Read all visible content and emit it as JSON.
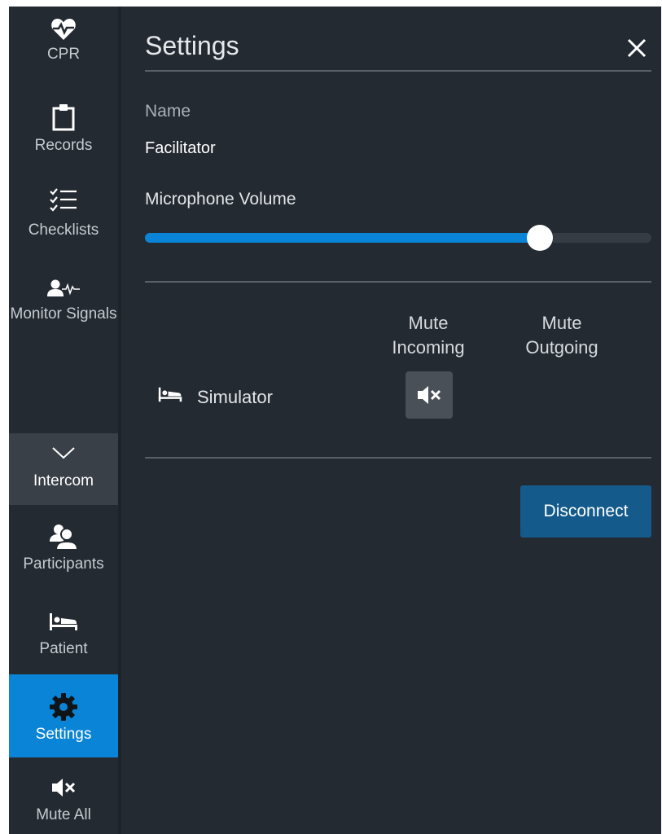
{
  "sidebar": {
    "items": [
      {
        "id": "cpr",
        "label": "CPR",
        "icon": "heart-pulse-icon"
      },
      {
        "id": "records",
        "label": "Records",
        "icon": "clipboard-icon"
      },
      {
        "id": "checklists",
        "label": "Checklists",
        "icon": "checklist-icon"
      },
      {
        "id": "monitor-signals",
        "label": "Monitor Signals",
        "icon": "patient-monitor-icon"
      },
      {
        "id": "intercom",
        "label": "Intercom",
        "icon": "chevron-down-icon"
      },
      {
        "id": "participants",
        "label": "Participants",
        "icon": "participants-icon"
      },
      {
        "id": "patient",
        "label": "Patient",
        "icon": "bed-icon"
      },
      {
        "id": "settings",
        "label": "Settings",
        "icon": "gear-icon",
        "active": true
      },
      {
        "id": "mute-all",
        "label": "Mute All",
        "icon": "speaker-mute-icon"
      }
    ]
  },
  "panel": {
    "title": "Settings",
    "name_label": "Name",
    "name_value": "Facilitator",
    "mic_label": "Microphone Volume",
    "mic_volume_fraction": 0.78,
    "columns": {
      "mute_incoming": "Mute Incoming",
      "mute_outgoing": "Mute Outgoing"
    },
    "device": {
      "name": "Simulator",
      "icon": "bed-icon",
      "incoming_muted": true
    },
    "disconnect_label": "Disconnect"
  },
  "colors": {
    "background": "#242a31",
    "accent": "#0a84d6",
    "button": "#145b8c"
  }
}
